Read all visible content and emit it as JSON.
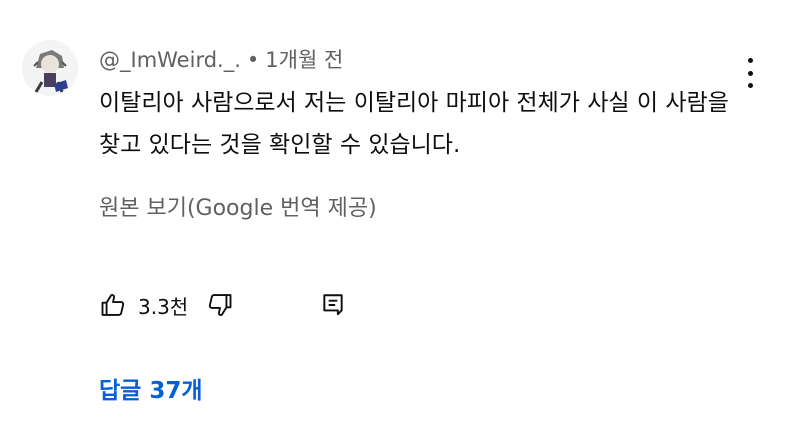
{
  "comment": {
    "author": "@_ImWeird._.",
    "separator": "•",
    "time": "1개월 전",
    "text": "이탈리아 사람으로서 저는 이탈리아 마피아 전체가 사실 이 사람을 찾고 있다는 것을 확인할 수 있습니다.",
    "translate_link": "원본 보기(Google 번역 제공)",
    "like_count": "3.3천",
    "replies_link": "답글 37개"
  },
  "icons": {
    "avatar": "avatar-image",
    "menu": "more-vertical-icon",
    "like": "thumbs-up-icon",
    "dislike": "thumbs-down-icon",
    "reply": "reply-comment-icon"
  },
  "colors": {
    "link": "#065fd4",
    "secondary_text": "#606060",
    "primary_text": "#0f0f0f"
  }
}
